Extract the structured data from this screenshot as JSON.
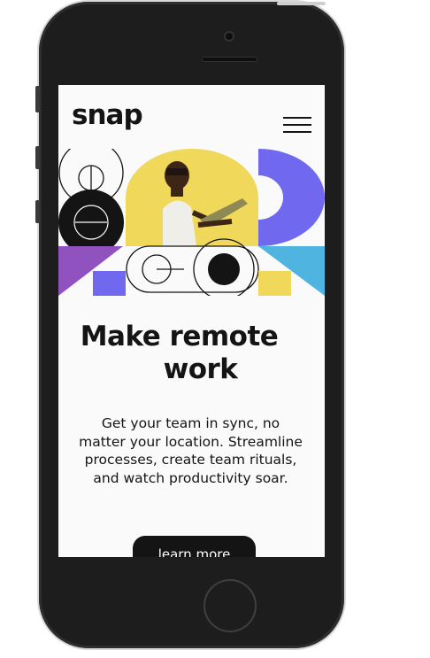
{
  "app": {
    "logo": "snap",
    "menu_icon": "hamburger-menu-icon"
  },
  "hero": {
    "image_description_icon": "remote-worker-illustration"
  },
  "content": {
    "headline_line1": "Make remote",
    "headline_line2": "work",
    "description": "Get your team in sync, no matter your location. Streamline processes, create team rituals, and watch productivity soar.",
    "cta_label": "learn more"
  },
  "colors": {
    "accent_purple": "#7069ef",
    "accent_yellow": "#f0d85a",
    "accent_blue": "#4fb4e0",
    "accent_violet": "#8f52be",
    "text": "#141414",
    "background": "#fafafa"
  }
}
